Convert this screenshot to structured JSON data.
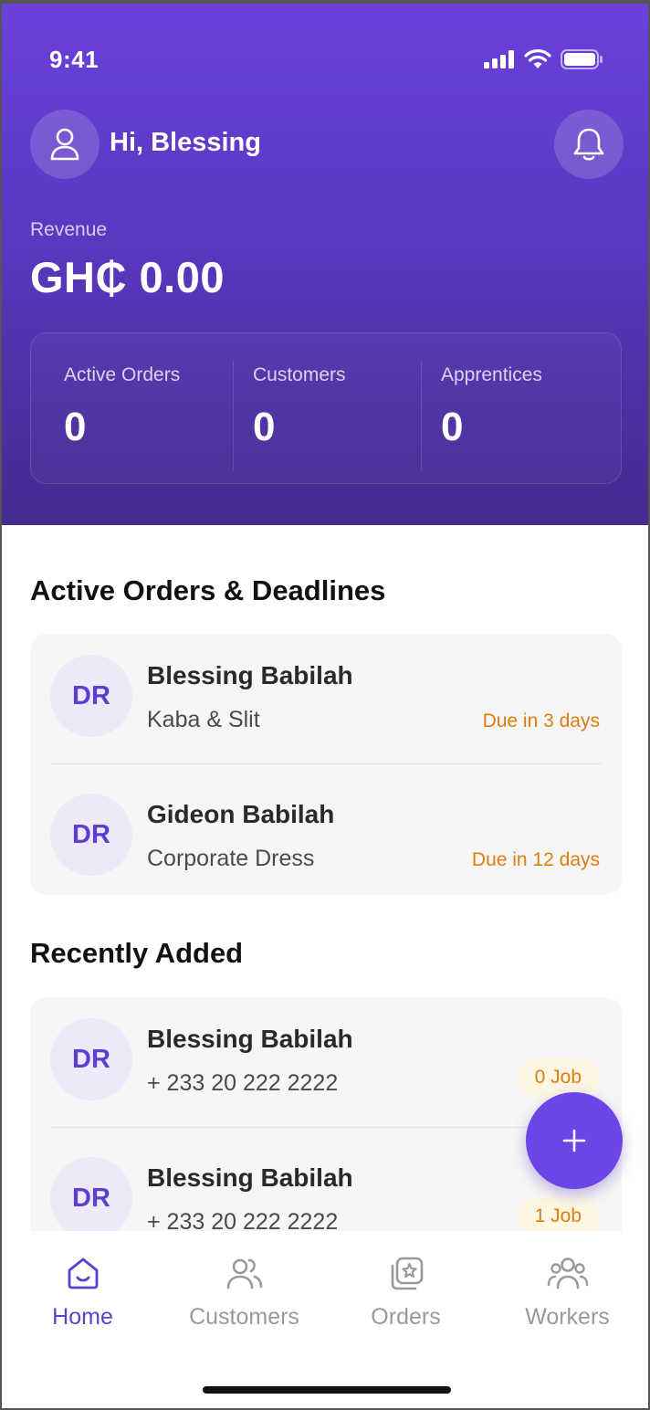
{
  "status": {
    "time": "9:41"
  },
  "header": {
    "greeting": "Hi, Blessing",
    "revenue_label": "Revenue",
    "revenue_value": "GH₵ 0.00"
  },
  "stats": [
    {
      "label": "Active Orders",
      "value": "0"
    },
    {
      "label": "Customers",
      "value": "0"
    },
    {
      "label": "Apprentices",
      "value": "0"
    }
  ],
  "active_orders": {
    "title": "Active Orders & Deadlines",
    "items": [
      {
        "initials": "DR",
        "name": "Blessing Babilah",
        "item": "Kaba & Slit",
        "due": "Due in 3 days"
      },
      {
        "initials": "DR",
        "name": "Gideon Babilah",
        "item": "Corporate Dress",
        "due": "Due in 12 days"
      }
    ]
  },
  "recent": {
    "title": "Recently Added",
    "items": [
      {
        "initials": "DR",
        "name": "Blessing Babilah",
        "phone": "+ 233 20 222 2222",
        "jobs": "0 Job"
      },
      {
        "initials": "DR",
        "name": "Blessing Babilah",
        "phone": "+ 233 20 222 2222",
        "jobs": "1 Job"
      }
    ]
  },
  "fab": {
    "icon": "plus-icon"
  },
  "tabs": [
    {
      "label": "Home",
      "icon": "home-icon",
      "active": true
    },
    {
      "label": "Customers",
      "icon": "customers-icon",
      "active": false
    },
    {
      "label": "Orders",
      "icon": "orders-icon",
      "active": false
    },
    {
      "label": "Workers",
      "icon": "workers-icon",
      "active": false
    }
  ],
  "colors": {
    "accent": "#6c45e6",
    "header_top": "#6a40db",
    "header_bottom": "#44298f",
    "due": "#e07d10",
    "tab_inactive": "#9a9a9a"
  }
}
